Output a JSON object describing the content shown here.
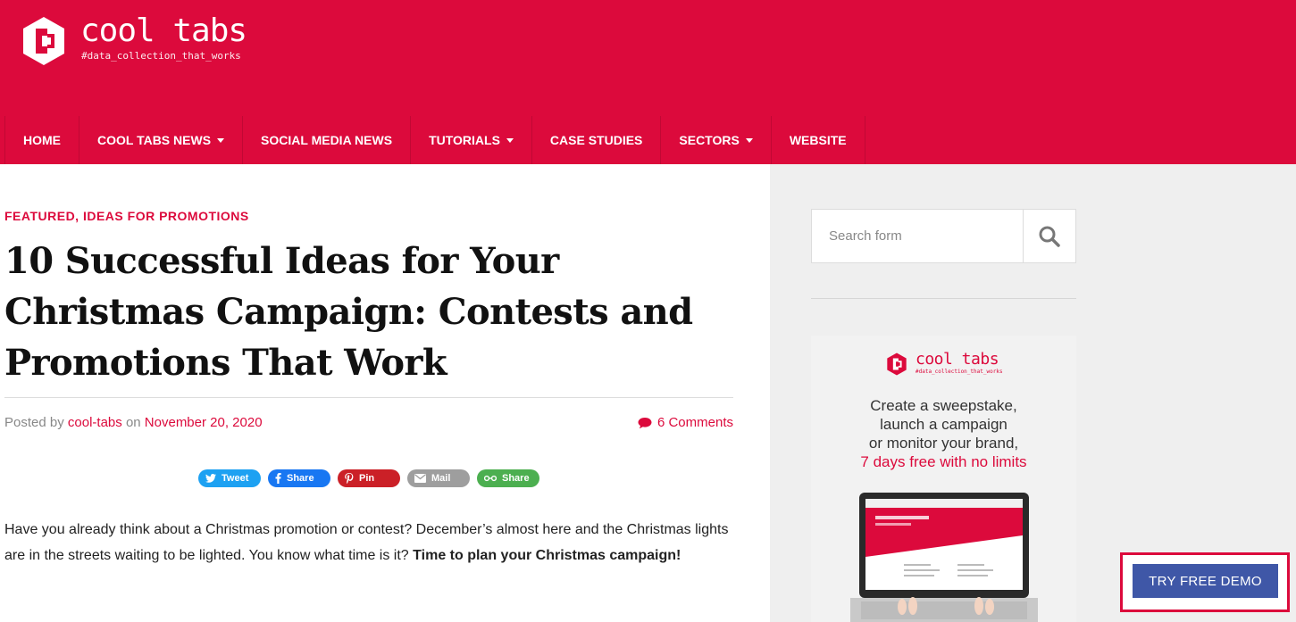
{
  "header": {
    "brand": "cool tabs",
    "tagline": "#data_collection_that_works",
    "brand_color": "#dc0a3c"
  },
  "nav": {
    "items": [
      {
        "label": "HOME",
        "has_dropdown": false
      },
      {
        "label": "COOL TABS NEWS",
        "has_dropdown": true
      },
      {
        "label": "SOCIAL MEDIA NEWS",
        "has_dropdown": false
      },
      {
        "label": "TUTORIALS",
        "has_dropdown": true
      },
      {
        "label": "CASE STUDIES",
        "has_dropdown": false
      },
      {
        "label": "SECTORS",
        "has_dropdown": true
      },
      {
        "label": "WEBSITE",
        "has_dropdown": false
      }
    ]
  },
  "article": {
    "categories": "FEATURED, IDEAS FOR PROMOTIONS",
    "title": "10 Successful Ideas for Your Christmas Campaign: Contests and Promotions That Work",
    "meta": {
      "posted_by": "Posted by",
      "author": "cool-tabs",
      "on": "on",
      "date": "November 20, 2020"
    },
    "comments": "6 Comments",
    "share_buttons": [
      {
        "label": "Tweet",
        "icon": "twitter-icon",
        "color": "#1da1f2"
      },
      {
        "label": "Share",
        "icon": "facebook-icon",
        "color": "#1877f2"
      },
      {
        "label": "Pin",
        "icon": "pinterest-icon",
        "color": "#cb2027"
      },
      {
        "label": "Mail",
        "icon": "mail-icon",
        "color": "#9e9e9e"
      },
      {
        "label": "Share",
        "icon": "more-share-icon",
        "color": "#4caf50"
      }
    ],
    "body_part1": "Have you already think about a Christmas promotion or contest? December’s almost here and the Christmas lights are in the streets waiting to be lighted. You know what time is it? ",
    "body_bold": "Time to plan your Christmas campaign!"
  },
  "sidebar": {
    "search_placeholder": "Search form",
    "ad": {
      "brand": "cool tabs",
      "tagline": "#data_collection_that_works",
      "line1": "Create a sweepstake,",
      "line2": "launch a campaign",
      "line3": "or monitor your brand,",
      "line4": "7 days free with no limits"
    }
  },
  "cta": {
    "label": "TRY FREE DEMO",
    "color": "#3f57a7"
  }
}
